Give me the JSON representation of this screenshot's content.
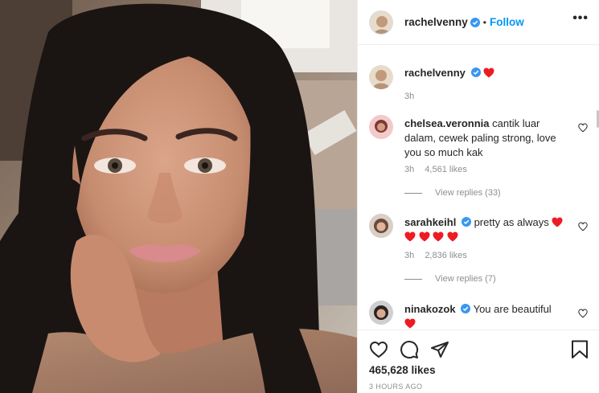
{
  "post": {
    "author": "rachelvenny",
    "follow_label": "Follow",
    "dot": "•",
    "more_label": "•••",
    "caption_author": "rachelvenny",
    "caption_age": "3h"
  },
  "comments": [
    {
      "user": "chelsea.veronnia",
      "text": "cantik luar dalam, cewek paling strong, love you so much kak",
      "age": "3h",
      "likes": "4,561 likes",
      "replies": "View replies (33)"
    },
    {
      "user": "sarahkeihl",
      "text": "pretty as always",
      "age": "3h",
      "likes": "2,836 likes",
      "replies": "View replies (7)"
    },
    {
      "user": "ninakozok",
      "text": "You are beautiful"
    }
  ],
  "footer": {
    "likes": "465,628 likes",
    "time": "3 HOURS AGO"
  },
  "icons": {
    "like": "heart-icon",
    "comment": "comment-icon",
    "share": "paper-plane-icon",
    "save": "bookmark-icon",
    "verified": "verified-badge-icon",
    "red_heart": "red-heart-emoji"
  },
  "colors": {
    "link_blue": "#0095f6",
    "verified_blue": "#3897f0",
    "heart_red": "#ed1c24",
    "muted_gray": "#8e8e8e",
    "text": "#262626"
  }
}
